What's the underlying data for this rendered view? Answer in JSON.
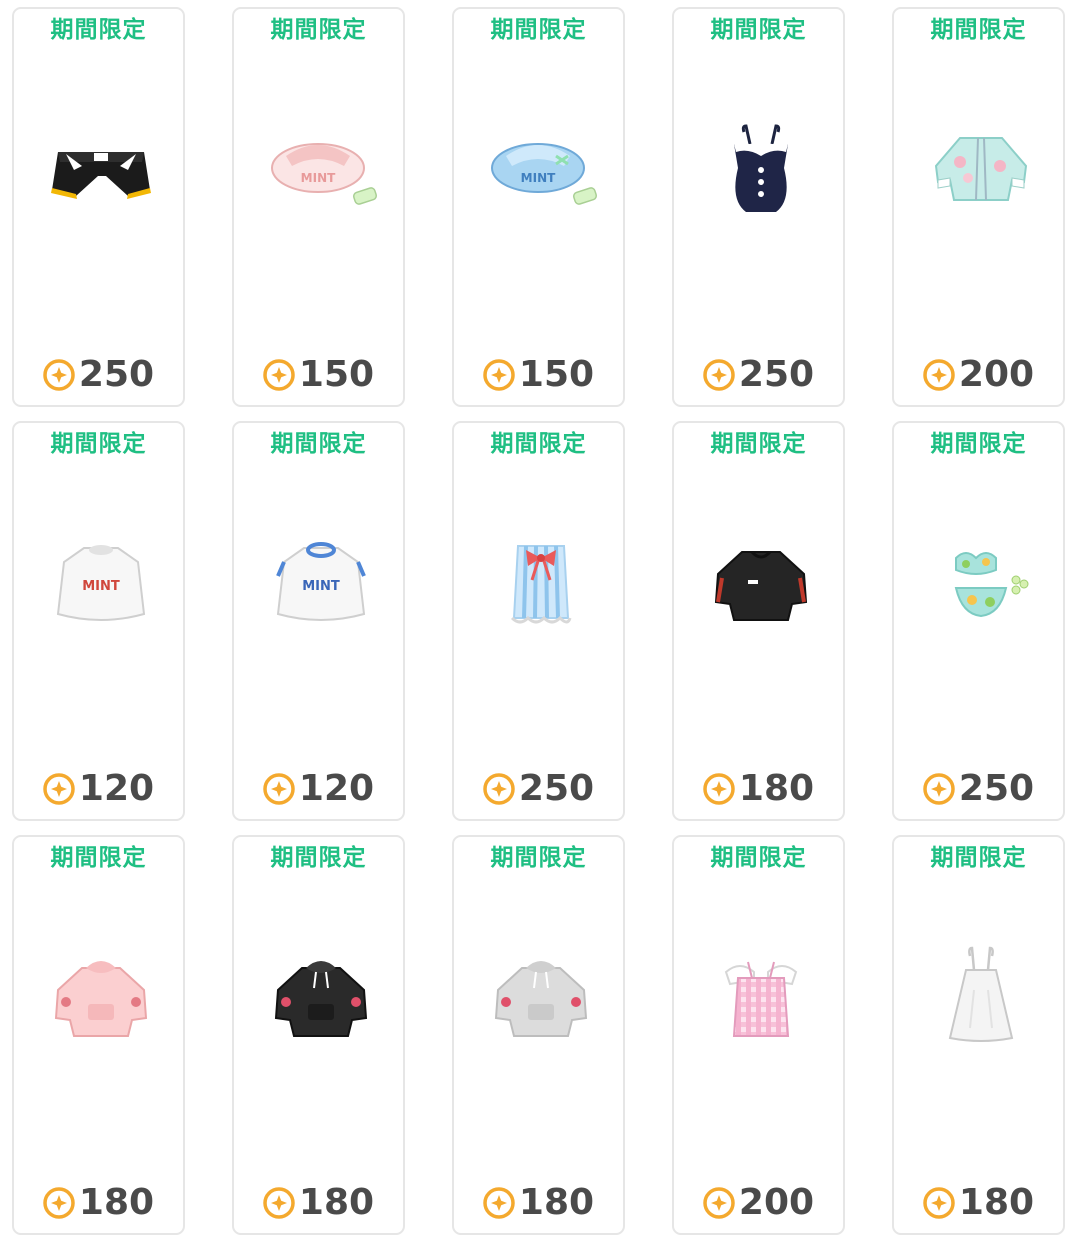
{
  "colors": {
    "tag": "#1fbf83",
    "coin": "#f4a92e",
    "price": "#4a4a4a",
    "border": "#e6e6e6"
  },
  "items": [
    {
      "tag": "期間限定",
      "price": "250",
      "icon": "black-shorts-icon"
    },
    {
      "tag": "期間限定",
      "price": "150",
      "icon": "pink-mint-cap-icon"
    },
    {
      "tag": "期間限定",
      "price": "150",
      "icon": "blue-mint-cap-icon"
    },
    {
      "tag": "期間限定",
      "price": "250",
      "icon": "navy-swimsuit-icon"
    },
    {
      "tag": "期間限定",
      "price": "200",
      "icon": "mint-floral-jacket-icon"
    },
    {
      "tag": "期間限定",
      "price": "120",
      "icon": "white-mint-tshirt-red-icon"
    },
    {
      "tag": "期間限定",
      "price": "120",
      "icon": "white-mint-tshirt-blue-icon"
    },
    {
      "tag": "期間限定",
      "price": "250",
      "icon": "striped-ribbon-dress-icon"
    },
    {
      "tag": "期間限定",
      "price": "180",
      "icon": "black-track-jacket-icon"
    },
    {
      "tag": "期間限定",
      "price": "250",
      "icon": "fruit-bikini-icon"
    },
    {
      "tag": "期間限定",
      "price": "180",
      "icon": "pink-rose-hoodie-icon"
    },
    {
      "tag": "期間限定",
      "price": "180",
      "icon": "black-rose-hoodie-icon"
    },
    {
      "tag": "期間限定",
      "price": "180",
      "icon": "gray-rose-hoodie-icon"
    },
    {
      "tag": "期間限定",
      "price": "200",
      "icon": "pink-gingham-top-icon"
    },
    {
      "tag": "期間限定",
      "price": "180",
      "icon": "white-slip-dress-icon"
    }
  ]
}
